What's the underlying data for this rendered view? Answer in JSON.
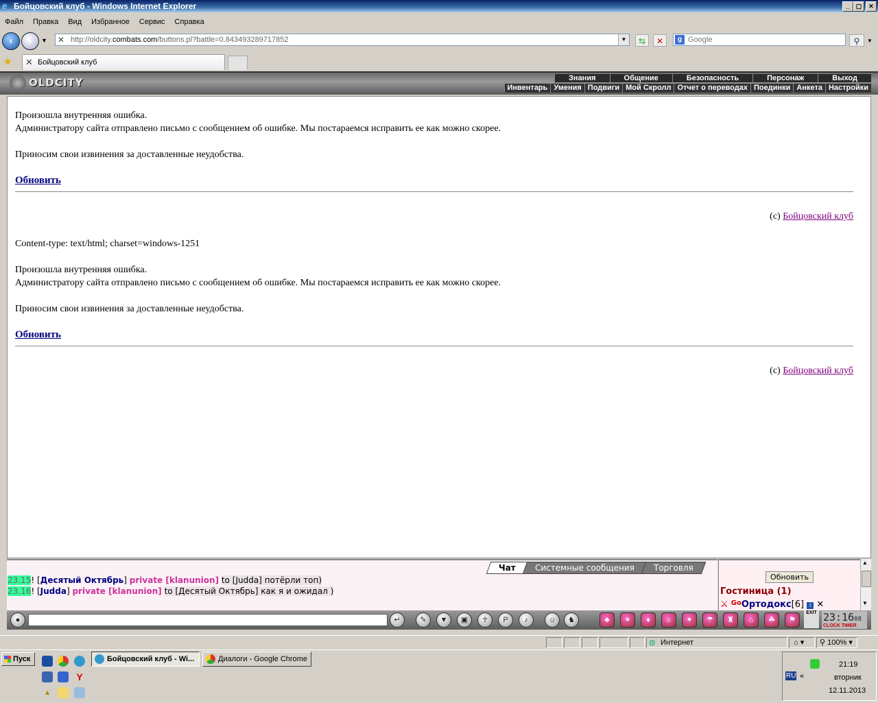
{
  "window": {
    "title": "Бойцовский клуб - Windows Internet Explorer",
    "min": "_",
    "max": "▢",
    "close": "✕"
  },
  "menu": [
    "Файл",
    "Правка",
    "Вид",
    "Избранное",
    "Сервис",
    "Справка"
  ],
  "address": {
    "url_prefix": "http://oldcity.",
    "url_domain": "combats.com",
    "url_suffix": "/buttons.pl?battle=0.843493289717852"
  },
  "search": {
    "placeholder": "Google"
  },
  "tab": {
    "title": "Бойцовский клуб"
  },
  "game": {
    "logo": "OLDCITY",
    "top_nav": [
      "Знания",
      "Общение",
      "Безопасность",
      "Персонаж",
      "Выход"
    ],
    "sub_nav": [
      "Инвентарь",
      "Умения",
      "Подвиги",
      "Мой Скролл",
      "Отчет о переводах",
      "Поединки",
      "Анкета",
      "Настройки"
    ]
  },
  "content": {
    "error_line1": "Произошла внутренняя ошибка.",
    "error_line2": "Администратору сайта отправлено письмо с сообщением об ошибке. Мы постараемся исправить ее как можно скорее.",
    "apology": "Приносим свои извинения за доставленные неудобства.",
    "refresh": "Обновить",
    "copyright_prefix": "(c) ",
    "copyright_link": "Бойцовский клуб",
    "content_type": "Content-type: text/html; charset=windows-1251"
  },
  "chat": {
    "tabs": [
      "Чат",
      "Системные сообщения",
      "Торговля"
    ],
    "lines": [
      {
        "time": "23.15",
        "from": "Десятый Октябрь",
        "priv": "private [klanunion]",
        "to": "to [Judda]",
        "msg": "потёрли топ)"
      },
      {
        "time": "23.16",
        "from": "Judda",
        "priv": "private [klanunion]",
        "to": "to [Десятый Октябрь]",
        "msg": "как я и ожидал )"
      }
    ]
  },
  "room": {
    "refresh": "Обновить",
    "name": "Гостиница (1)",
    "go": "Go",
    "user": "Ортодокс",
    "level": "[6]"
  },
  "clock": {
    "time": "23:16",
    "sec": "08",
    "labels": "CLOCK TIMER",
    "exit": "EXIT"
  },
  "statusbar": {
    "zone": "Интернет",
    "zoom": "100%"
  },
  "taskbar": {
    "start": "Пуск",
    "tasks": [
      "Бойцовский клуб - Wi...",
      "Диалоги - Google Chrome"
    ],
    "lang": "RU",
    "time": "21:19",
    "day": "вторник",
    "date": "12.11.2013"
  }
}
